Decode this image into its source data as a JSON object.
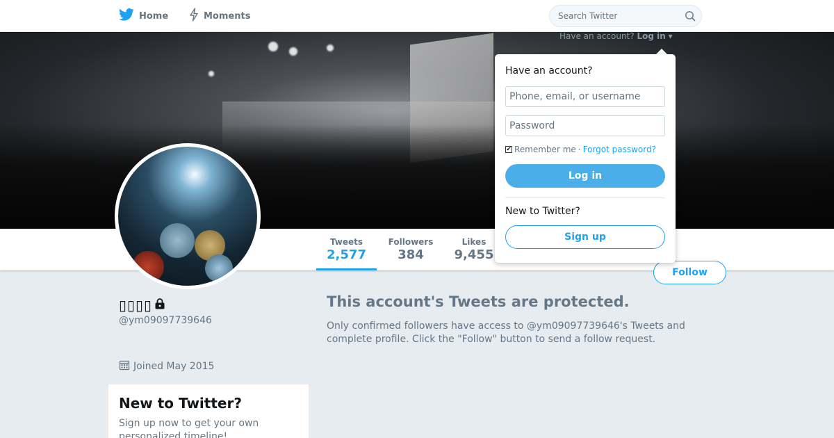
{
  "nav": {
    "home_label": "Home",
    "moments_label": "Moments",
    "search_placeholder": "Search Twitter"
  },
  "header": {
    "have_account_text": "Have an account?",
    "login_link": "Log in"
  },
  "stats": {
    "tweets_label": "Tweets",
    "tweets_value": "2,577",
    "followers_label": "Followers",
    "followers_value": "384",
    "likes_label": "Likes",
    "likes_value": "9,455"
  },
  "profile": {
    "display_name": "▯▯▯▯",
    "handle": "@ym09097739646",
    "joined": "Joined May 2015",
    "follow_label": "Follow"
  },
  "protected": {
    "title": "This account's Tweets are protected.",
    "body": "Only confirmed followers have access to @ym09097739646's Tweets and complete profile. Click the \"Follow\" button to send a follow request."
  },
  "signup_card": {
    "title": "New to Twitter?",
    "body": "Sign up now to get your own personalized timeline!"
  },
  "login_dropdown": {
    "heading": "Have an account?",
    "username_placeholder": "Phone, email, or username",
    "password_placeholder": "Password",
    "remember_label": "Remember me",
    "separator": "·",
    "forgot_label": "Forgot password?",
    "login_button": "Log in",
    "new_heading": "New to Twitter?",
    "signup_button": "Sign up"
  },
  "colors": {
    "accent": "#1da1f2",
    "background": "#e6ecf0",
    "muted_text": "#657786"
  }
}
